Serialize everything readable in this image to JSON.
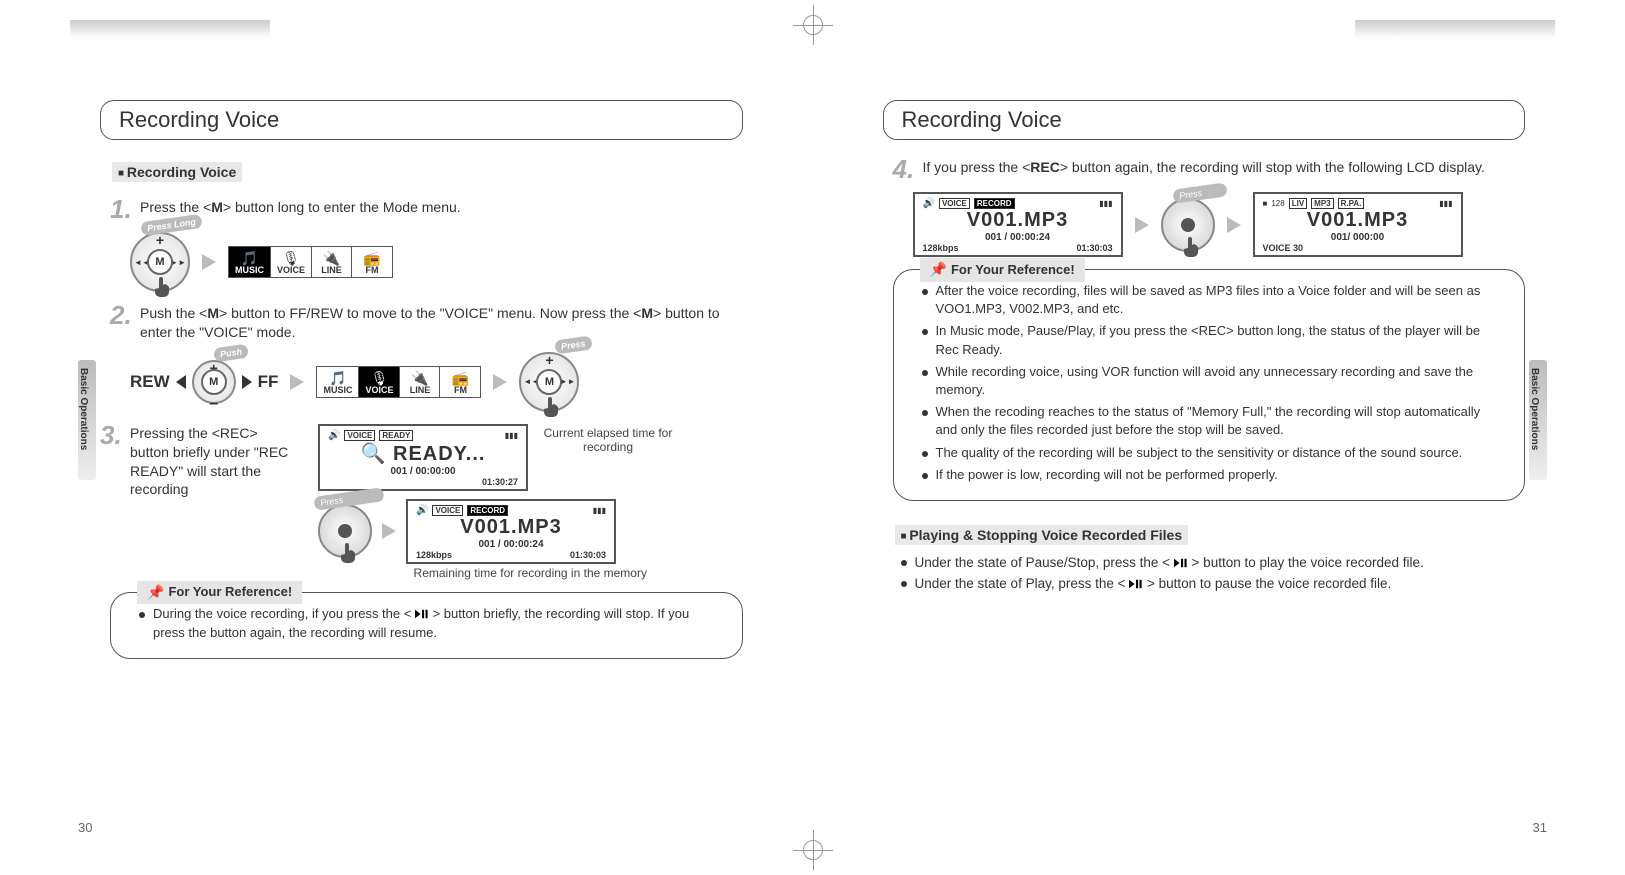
{
  "left": {
    "heading": "Recording Voice",
    "sideTab": "Basic Operations",
    "section1": "Recording Voice",
    "step1Before": "Press the <",
    "step1Key": "M",
    "step1After": "> button long to enter the Mode menu.",
    "badgePressLong": "Press Long",
    "menu": {
      "items": [
        "MUSIC",
        "VOICE",
        "LINE",
        "FM"
      ],
      "selected": 0
    },
    "step2a": "Push the <",
    "step2b": "> button to FF/REW to move to the \"VOICE\" menu. Now press the <",
    "step2c": "> button to enter the \"VOICE\" mode.",
    "rew": "REW",
    "ff": "FF",
    "badgePush": "Push",
    "menu2selected": 1,
    "badgePress": "Press",
    "lcdReady": {
      "voice": "VOICE",
      "status": "READY",
      "big": "READY...",
      "mid": "001 / 00:00:00",
      "time": "01:30:27"
    },
    "step3": "Pressing the <REC> button briefly under \"REC READY\" will start the recording",
    "captionElapsed": "Current elapsed time for recording",
    "lcdRec": {
      "voice": "VOICE",
      "status": "RECORD",
      "big": "V001.MP3",
      "mid": "001 / 00:00:24",
      "time": "01:30:03",
      "rate": "128kbps"
    },
    "captionRemain": "Remaining time for recording in the memory",
    "refTitle": "For Your Reference!",
    "ref1a": "During the voice recording, if you press the < ",
    "ref1b": " > button briefly, the recording will stop. If you press the button again, the recording will resume.",
    "pageNum": "30"
  },
  "right": {
    "heading": "Recording Voice",
    "sideTab": "Basic Operations",
    "step4a": "If you press the <",
    "step4key": "REC",
    "step4b": "> button again, the recording will stop with the following LCD display.",
    "lcdRec": {
      "voice": "VOICE",
      "status": "RECORD",
      "big": "V001.MP3",
      "mid": "001 / 00:00:24",
      "time": "01:30:03",
      "rate": "128kbps"
    },
    "badgePress": "Press",
    "lcdStopped": {
      "rate": "128",
      "liv": "LIV",
      "mp3": "MP3",
      "rpa": "R.PA.",
      "big": "V001.MP3",
      "mid": "001/  000:00",
      "voice": "VOICE",
      "vol": "30"
    },
    "refTitle": "For Your Reference!",
    "refItems": [
      "After the voice recording, files will be saved as MP3 files into a Voice folder and will be seen as VOO1.MP3, V002.MP3, and etc.",
      "In Music mode, Pause/Play, if you press the <REC> button long, the status of the player will be Rec Ready.",
      "While recording voice, using VOR function will avoid any unnecessary recording and save the memory.",
      "When the recoding reaches to the status of \"Memory Full,\" the recording will stop automatically and only the files recorded just before the stop will be saved.",
      "The quality of the recording will be subject to the sensitivity or distance of the sound source.",
      "If the power is low, recording will not be performed properly."
    ],
    "section2": "Playing & Stopping Voice Recorded Files",
    "b1a": "Under the state of Pause/Stop, press the < ",
    "b1b": " > button to play the voice recorded file.",
    "b2a": "Under the state of Play, press the < ",
    "b2b": " > button to pause the voice recorded file.",
    "pageNum": "31"
  }
}
